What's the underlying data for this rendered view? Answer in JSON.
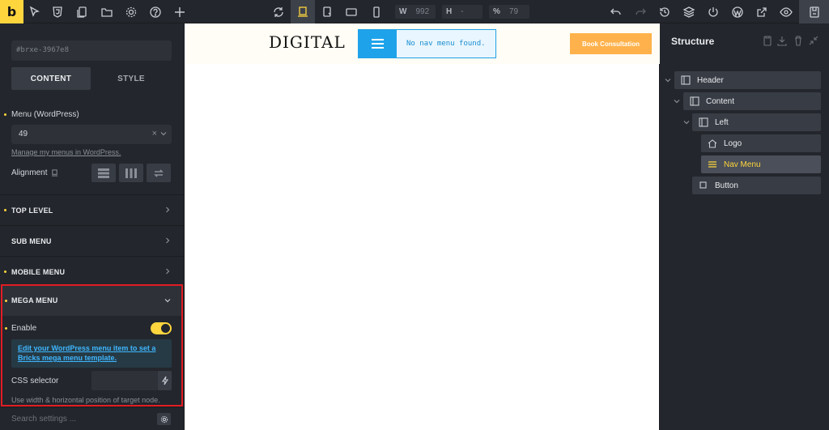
{
  "toolbar": {
    "logo": "b",
    "width_label": "W",
    "width_value": "992",
    "height_label": "H",
    "height_value": "-",
    "zoom_label": "%",
    "zoom_value": "79"
  },
  "left_panel": {
    "element_id": "#brxe-3967e8",
    "tabs": [
      "CONTENT",
      "STYLE"
    ],
    "menu_label": "Menu (WordPress)",
    "menu_value": "49",
    "menu_clear": "×",
    "manage_link": "Manage my menus in WordPress.",
    "alignment_label": "Alignment",
    "sections": [
      "TOP LEVEL",
      "SUB MENU",
      "MOBILE MENU"
    ],
    "mega": {
      "title": "MEGA MENU",
      "enable_label": "Enable",
      "enabled": true,
      "info": "Edit your WordPress menu item to set a Bricks mega menu template.",
      "css_label": "CSS selector",
      "hint": "Use width & horizontal position of target node."
    },
    "search_placeholder": "Search settings ..."
  },
  "canvas": {
    "logo_text": "DIGITAL",
    "nav_message": "No nav menu found.",
    "button": "Book Consultation"
  },
  "structure": {
    "title": "Structure",
    "nodes": [
      {
        "label": "Header"
      },
      {
        "label": "Content"
      },
      {
        "label": "Left"
      },
      {
        "label": "Logo"
      },
      {
        "label": "Nav Menu"
      },
      {
        "label": "Button"
      }
    ]
  },
  "colors": {
    "accent": "#ffd53e",
    "panel": "#23262c",
    "highlight_border": "#e11d24",
    "nav_blue": "#1ea3ea",
    "book_btn": "#ffb24b"
  }
}
